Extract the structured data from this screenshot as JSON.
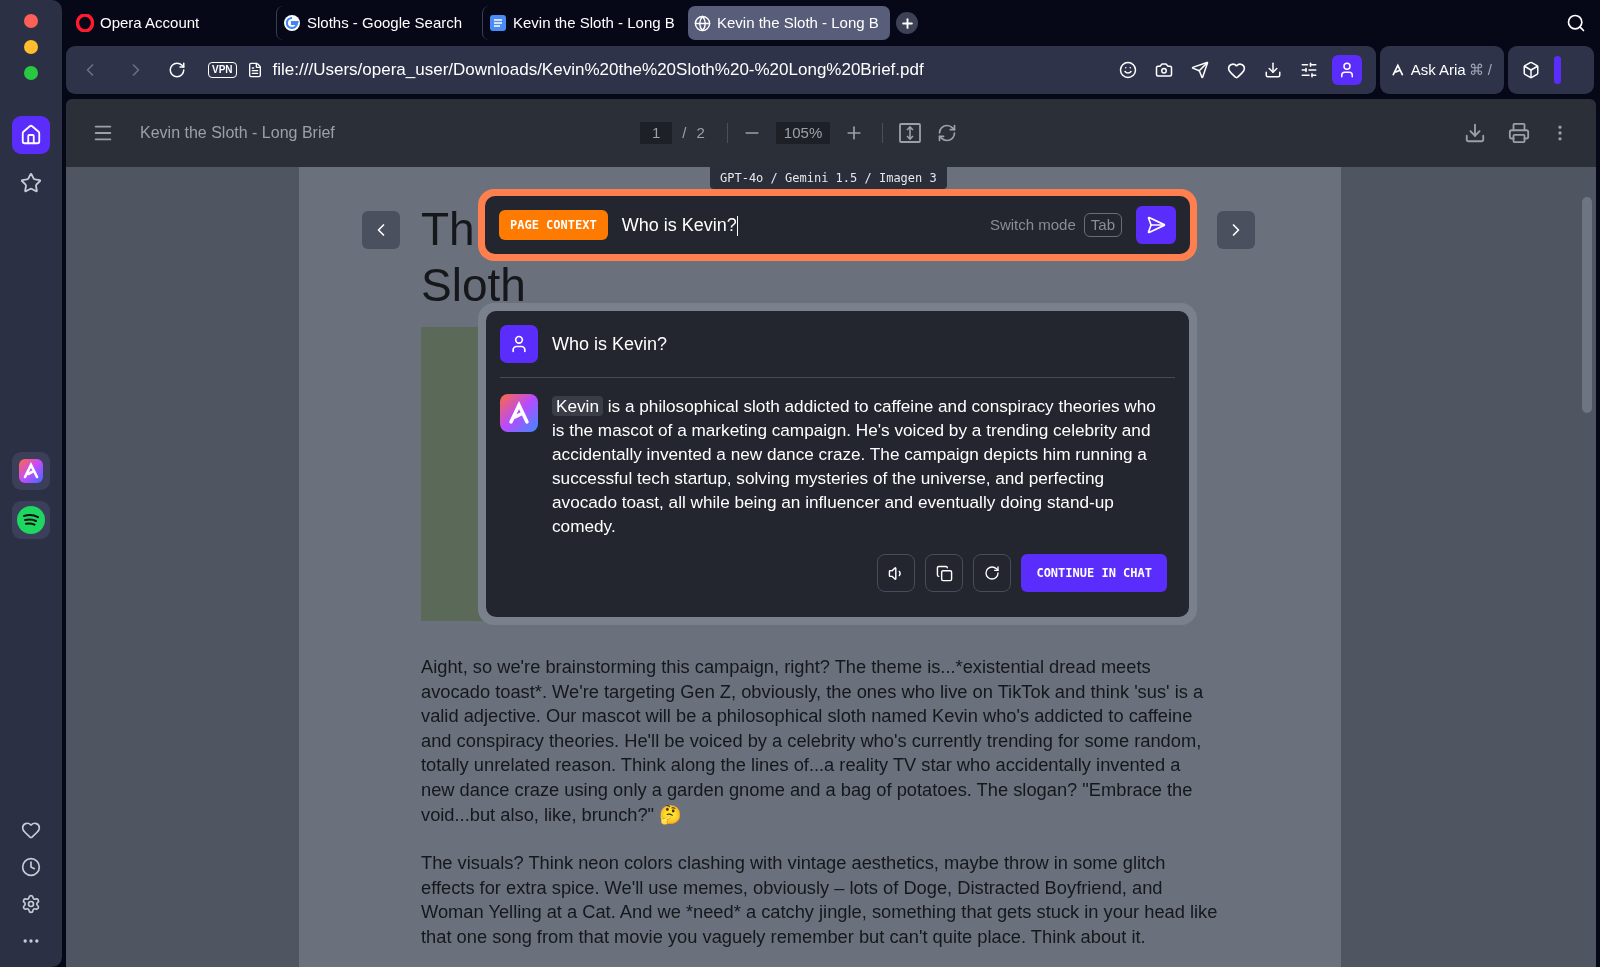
{
  "tabs": [
    {
      "label": "Opera Account",
      "kind": "opera",
      "selected": false
    },
    {
      "label": "Sloths - Google Search",
      "kind": "google",
      "selected": false
    },
    {
      "label": "Kevin the Sloth - Long B",
      "kind": "docs",
      "selected": false
    },
    {
      "label": "Kevin the Sloth - Long B",
      "kind": "globe",
      "selected": true
    }
  ],
  "address_bar": {
    "vpn": "VPN",
    "url": "file:///Users/opera_user/Downloads/Kevin%20the%20Sloth%20-%20Long%20Brief.pdf"
  },
  "aria_button": {
    "label": "Ask Aria",
    "shortcut": "⌘ /"
  },
  "sidebar": {
    "items": [
      {
        "kind": "home",
        "selected": true
      },
      {
        "kind": "star",
        "selected": false
      }
    ],
    "apps": [
      {
        "kind": "aria"
      },
      {
        "kind": "spotify"
      }
    ]
  },
  "pdf_toolbar": {
    "title": "Kevin the Sloth - Long Brief",
    "page": "1",
    "separator": "/",
    "pages": "2",
    "zoom": "105%"
  },
  "document": {
    "title_lines": [
      "Th",
      "Sloth"
    ],
    "paragraphs": [
      "Aight, so we're brainstorming this campaign, right?  The theme is...*existential dread meets avocado toast*.  We're targeting Gen Z, obviously, the ones who live on TikTok and think 'sus' is a valid adjective.  Our mascot will be a philosophical sloth named Kevin who's addicted to caffeine and conspiracy theories.  He'll be voiced by a celebrity who's currently trending for some random, totally unrelated reason.  Think along the lines of...a reality TV star who accidentally invented a new dance craze using only a garden gnome and a bag of potatoes.  The slogan?  \"Embrace the void...but also, like, brunch?\" 🤔",
      "The visuals? Think neon colors clashing with vintage aesthetics, maybe throw in some glitch effects for extra spice.  We'll use memes, obviously – lots of Doge, Distracted Boyfriend, and Woman Yelling at a Cat.  And we *need* a catchy jingle, something that gets stuck in your head like that one song from that movie you vaguely remember but can't quite place.  Think about it."
    ]
  },
  "aria_overlay": {
    "models": "GPT-4o / Gemini 1.5 / Imagen 3",
    "badge": "PAGE CONTEXT",
    "query": "Who is Kevin?",
    "switch_mode": "Switch mode",
    "key": "Tab",
    "question": "Who is Kevin?",
    "answer_highlight": "Kevin",
    "answer": " is a philosophical sloth addicted to caffeine and conspiracy theories who is the mascot of a marketing campaign. He's voiced by a trending celebrity and accidentally invented a new dance craze. The campaign depicts him running a successful tech startup, solving mysteries of the universe, and perfecting avocado toast, all while being an influencer and eventually doing stand-up comedy.",
    "continue_button": "CONTINUE IN CHAT"
  }
}
